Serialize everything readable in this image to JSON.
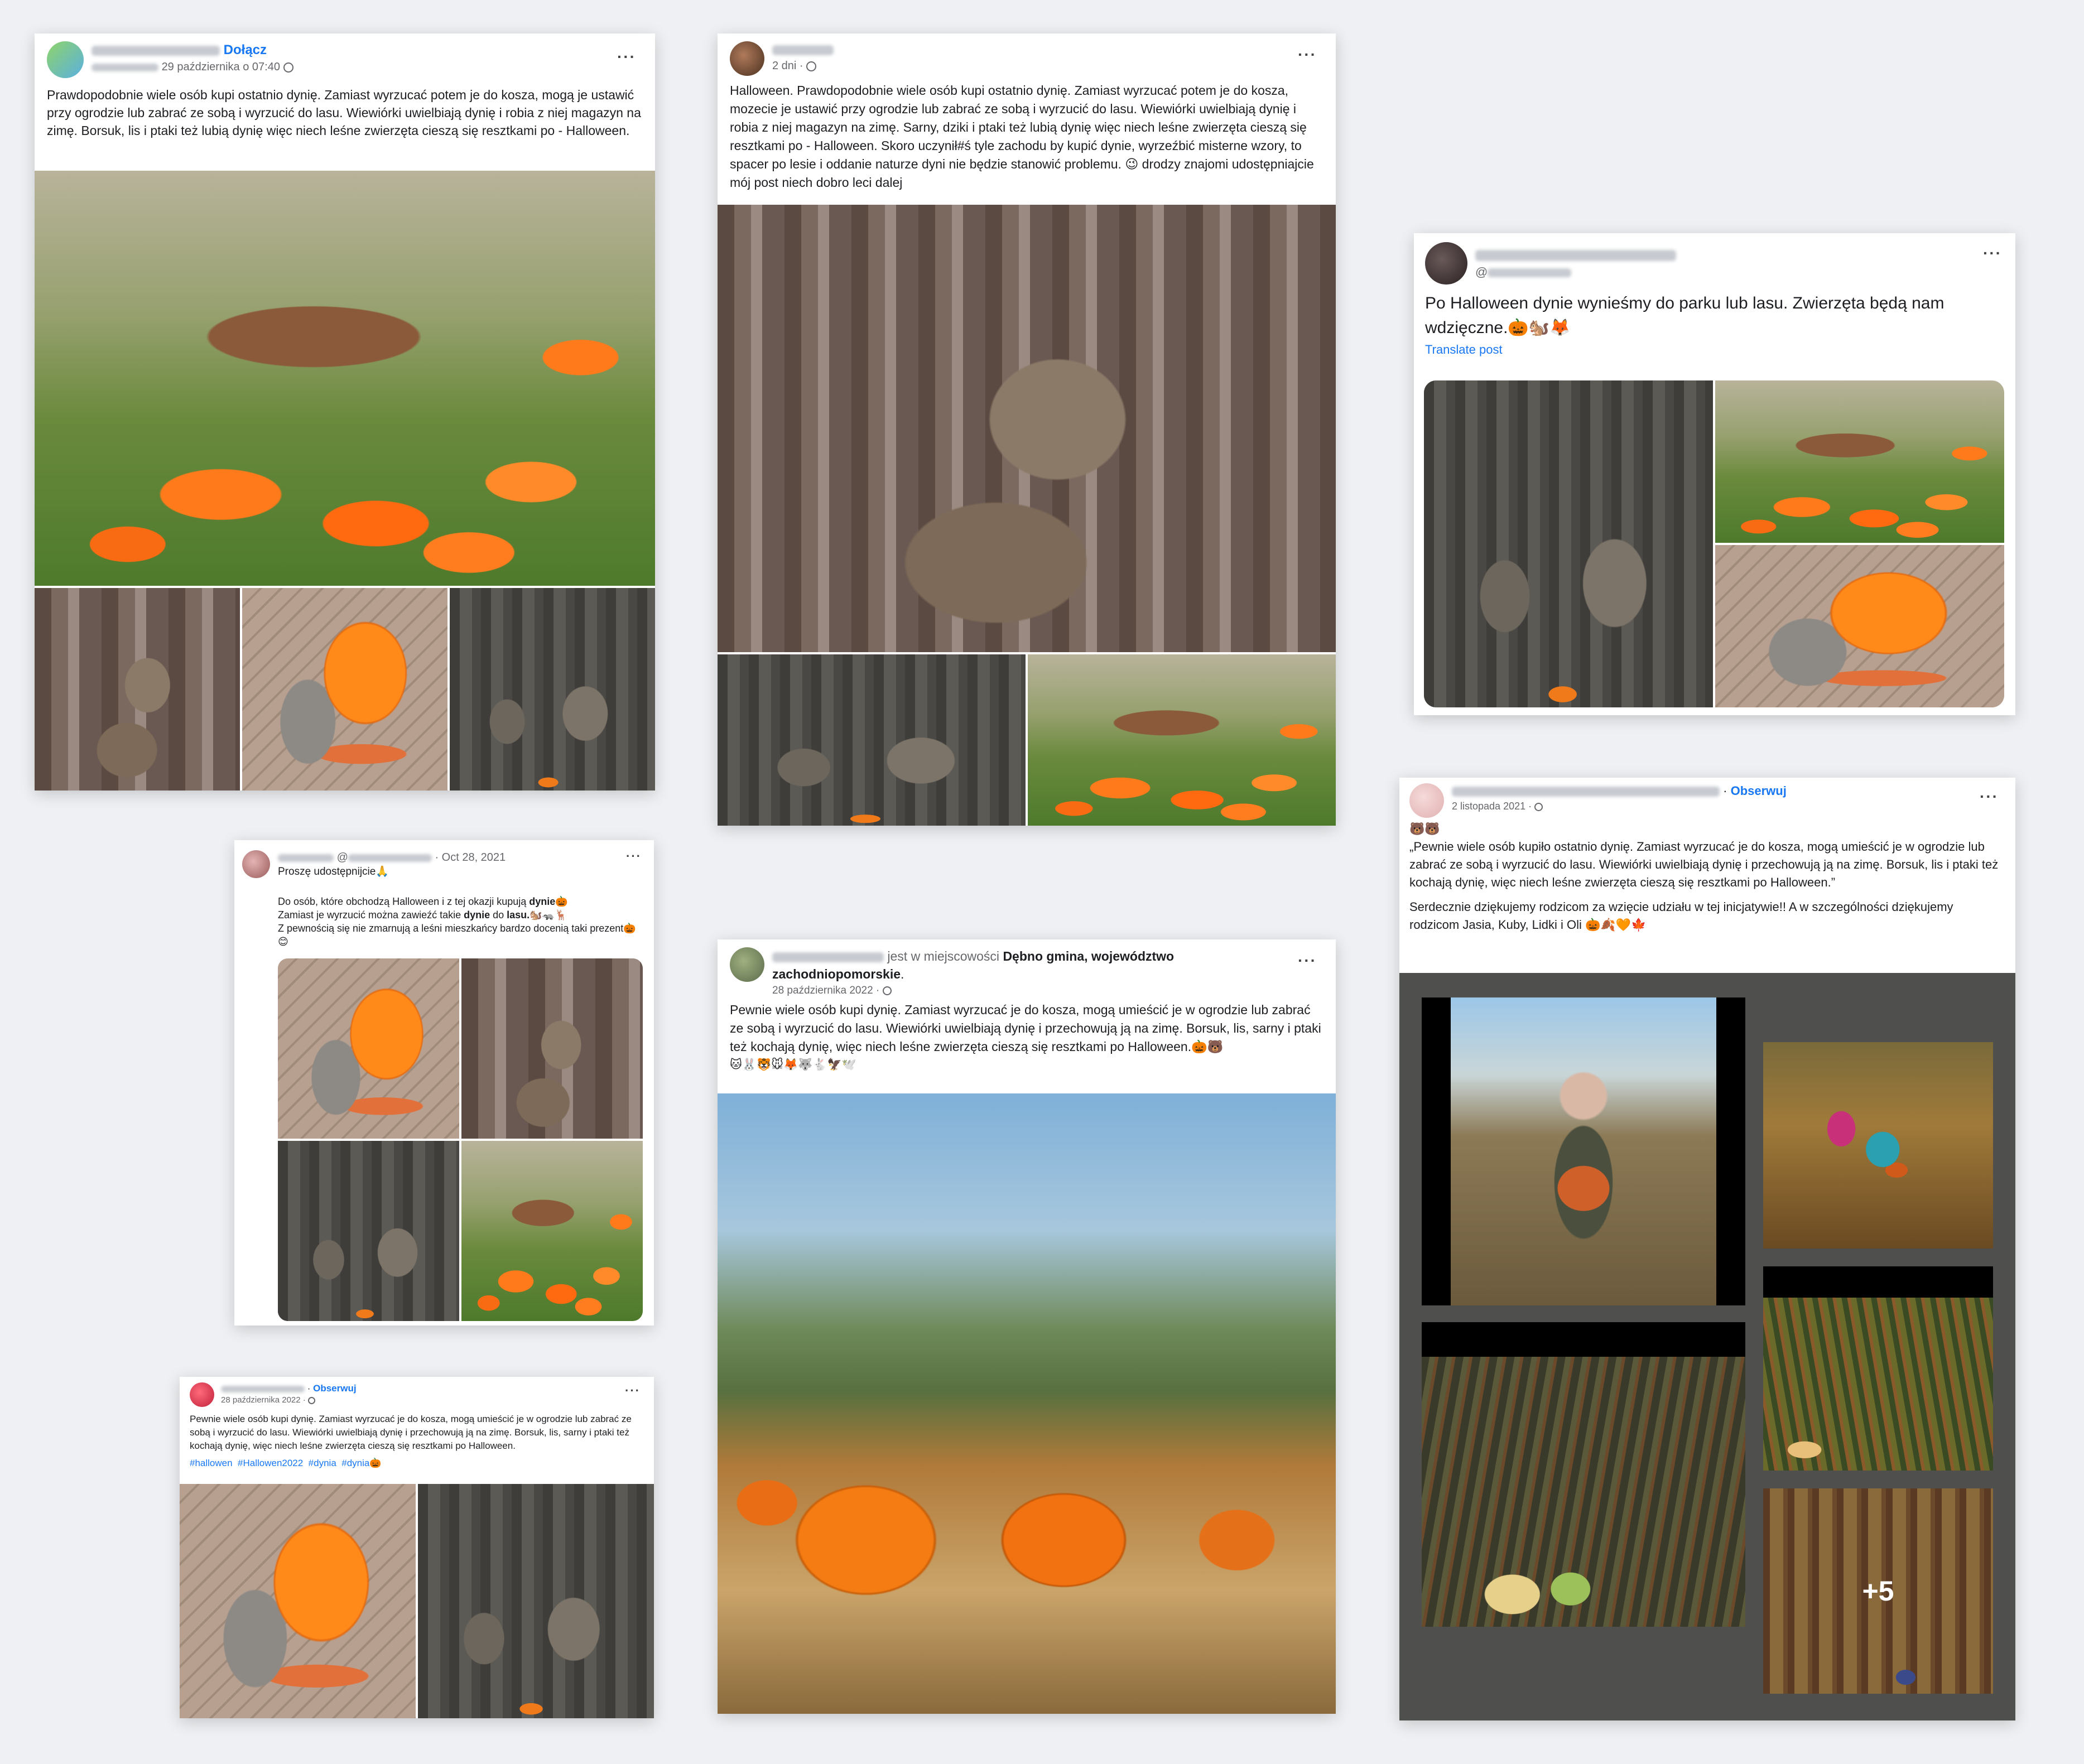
{
  "post1": {
    "join_label": "Dołącz",
    "date": "29 października o 07:40",
    "more": "···",
    "text": "Prawdopodobnie wiele osób kupi ostatnio dynię. Zamiast wyrzucać potem je do kosza, mogą je ustawić przy ogrodzie lub zabrać ze sobą i wyrzucić do lasu. Wiewiórki uwielbiają dynię i robia z niej magazyn na zimę. Borsuk, lis i ptaki też lubią dynię więc niech leśne zwierzęta cieszą się resztkami po - Halloween."
  },
  "post2": {
    "date": "2 dni",
    "more": "···",
    "text": "Halloween. Prawdopodobnie wiele osób kupi ostatnio dynię. Zamiast wyrzucać potem je do kosza, mozecie je ustawić przy ogrodzie lub zabrać ze sobą i wyrzucić do lasu. Wiewiórki uwielbiają dynię i robia z niej magazyn na zimę. Sarny, dziki i ptaki też lubią dynię więc niech leśne zwierzęta cieszą się resztkami po - Halloween. Skoro uczynił#ś tyle zachodu by kupić dynie, wyrzeźbić misterne wzory, to spacer po lesie i oddanie naturze dyni nie będzie stanowić problemu. 😉 drodzy znajomi udostępniajcie mój post niech dobro leci dalej"
  },
  "post3": {
    "handle_prefix": "@",
    "more": "···",
    "text": "Po Halloween dynie wynieśmy do parku lub lasu. Zwierzęta będą nam wdzięczne.🎃🐿️🦊",
    "translate": "Translate post"
  },
  "post4": {
    "at": "@",
    "date": "Oct 28, 2021",
    "more": "···",
    "line1": "Proszę udostępnijcie🙏",
    "p2_before": "Do osób, które obchodzą Halloween i z tej okazji kupują ",
    "p2_bold": "dynie",
    "p2_after": "🎃",
    "p3_before": "Zamiast je wyrzucić można zawieźć takie ",
    "p3_bold1": "dynie",
    "p3_mid": " do ",
    "p3_bold2": "lasu.",
    "p3_after": "🐿️🦡🦌",
    "p4": "Z pewnością się nie zmarnują a leśni mieszkańcy bardzo docenią taki prezent🎃😊"
  },
  "post5": {
    "follow": "Obserwuj",
    "date": "28 października 2022",
    "more": "···",
    "text": "Pewnie wiele osób kupi dynię. Zamiast wyrzucać je do kosza, mogą umieścić je w ogrodzie lub zabrać ze sobą i wyrzucić do lasu. Wiewiórki uwielbiają dynię i przechowują ją na zimę. Borsuk, lis, sarny i ptaki też kochają dynię, więc niech leśne zwierzęta cieszą się resztkami po Halloween.",
    "tags": [
      "#hallowen",
      "#Hallowen2022",
      "#dynia",
      "#dynia🎃"
    ]
  },
  "post6": {
    "location_prefix": "jest w miejscowości ",
    "location": "Dębno gmina, województwo zachodniopomorskie",
    "location_suffix": ".",
    "date": "28 października 2022",
    "more": "···",
    "text": "Pewnie wiele osób kupi dynię. Zamiast wyrzucać je do kosza, mogą umieścić je w ogrodzie lub zabrać ze sobą i wyrzucić do lasu. Wiewiórki uwielbiają dynię i przechowują ją na zimę. Borsuk, lis, sarny i ptaki też kochają dynię, więc niech leśne zwierzęta cieszą się resztkami po Halloween.🎃🐻",
    "emoji_line": "🐱🐰🐯🐭🦊🐺🐇🦅🕊️"
  },
  "post7": {
    "follow": "Obserwuj",
    "date": "2 listopada 2021",
    "more": "···",
    "emoji_top": "🐻🐻",
    "quote": "„Pewnie wiele osób kupiło ostatnio dynię. Zamiast wyrzucać je do kosza, mogą umieścić je w ogrodzie lub zabrać ze sobą i wyrzucić do lasu. Wiewiórki uwielbiają dynię i przechowują ją na zimę. Borsuk, lis i ptaki też kochają dynię, więc niech leśne zwierzęta cieszą się resztkami po Halloween.”",
    "thanks": "Serdecznie dziękujemy rodzicom za wzięcie udziału w tej inicjatywie!! A w szczególności dziękujemy rodzicom Jasia, Kuby, Lidki i Oli 🎃🍂🧡🍁",
    "more_photos": "+5"
  },
  "colors": {
    "link": "#1877f2",
    "meta": "#65676b",
    "dark_panel": "#4f4f4d",
    "bg": "#eef0f3"
  }
}
